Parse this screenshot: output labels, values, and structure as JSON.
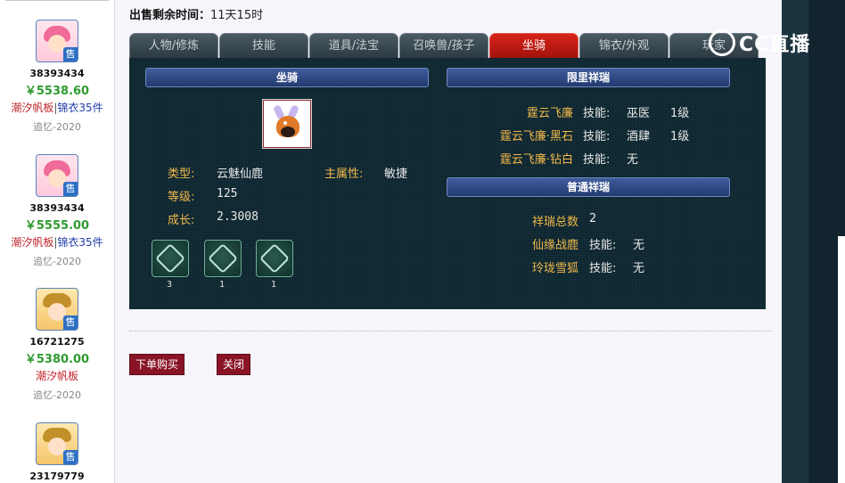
{
  "listings": [
    {
      "seller_id": "38393434",
      "price": "￥5538.60",
      "tag_primary": "潮汐帆板",
      "tag_secondary": "锦衣35件",
      "server": "追忆-2020",
      "badge": "售",
      "avatar": "pink-hair-girl"
    },
    {
      "seller_id": "38393434",
      "price": "￥5555.00",
      "tag_primary": "潮汐帆板",
      "tag_secondary": "锦衣35件",
      "server": "追忆-2020",
      "badge": "售",
      "avatar": "pink-hair-girl"
    },
    {
      "seller_id": "16721275",
      "price": "￥5380.00",
      "tag_primary": "潮汐帆板",
      "tag_secondary": "",
      "server": "追忆-2020",
      "badge": "售",
      "avatar": "golden-crown-boy"
    },
    {
      "seller_id": "23179779",
      "price": "",
      "tag_primary": "",
      "tag_secondary": "",
      "server": "",
      "badge": "售",
      "avatar": "golden-crown-boy"
    }
  ],
  "sale_time": {
    "label": "出售剩余时间：",
    "value": "11天15时"
  },
  "tabs": [
    "人物/修炼",
    "技能",
    "道具/法宝",
    "召唤兽/孩子",
    "坐骑",
    "锦衣/外观",
    "玩家"
  ],
  "active_tab": "坐骑",
  "mount": {
    "section_title": "坐骑",
    "type_label": "类型:",
    "type_value": "云魅仙鹿",
    "main_attr_label": "主属性:",
    "main_attr_value": "敏捷",
    "level_label": "等级:",
    "level_value": "125",
    "growth_label": "成长:",
    "growth_value": "2.3008",
    "skills": [
      {
        "icon": "skill-emblem-icon",
        "count": "3"
      },
      {
        "icon": "skill-emblem-icon",
        "count": "1"
      },
      {
        "icon": "skill-emblem-icon",
        "count": "1"
      }
    ]
  },
  "limited": {
    "section_title": "限里祥瑞",
    "items": [
      {
        "name": "霆云飞廉",
        "skill_label": "技能:",
        "skill": "巫医",
        "level": "1级"
      },
      {
        "name": "霆云飞廉·黑石",
        "skill_label": "技能:",
        "skill": "酒肆",
        "level": "1级"
      },
      {
        "name": "霆云飞廉·钻白",
        "skill_label": "技能:",
        "skill": "无",
        "level": ""
      }
    ]
  },
  "normal": {
    "section_title": "普通祥瑞",
    "total_label": "祥瑞总数",
    "total_value": "2",
    "items": [
      {
        "name": "仙缘战鹿",
        "skill_label": "技能:",
        "skill": "无"
      },
      {
        "name": "玲珑雪狐",
        "skill_label": "技能:",
        "skill": "无"
      }
    ]
  },
  "buttons": {
    "buy": "下单购买",
    "close": "关闭"
  },
  "watermark": "CC直播",
  "colors": {
    "panel_bg": "#0e2731",
    "active_tab": "#c41c14",
    "label_gold": "#f2b94a",
    "price_green": "#2f9a2f",
    "button": "#8a1427"
  }
}
